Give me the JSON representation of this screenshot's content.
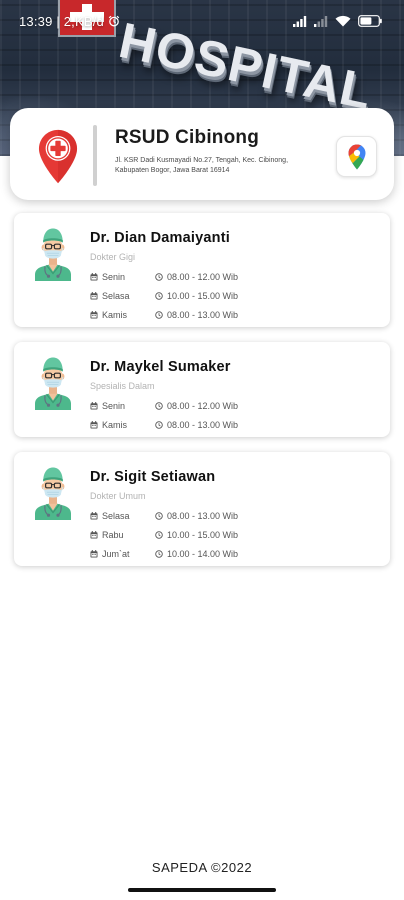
{
  "status_bar": {
    "time_text": "13:39 | 2,KB/d",
    "icons": [
      "alarm-icon",
      "signal-icon",
      "signal-icon",
      "wifi-icon",
      "battery-icon"
    ]
  },
  "header": {
    "sign_text": "HOSPITAL",
    "sign_icon": "red-cross-sign-icon"
  },
  "hospital": {
    "name": "RSUD Cibinong",
    "address": "Jl. KSR Dadi Kusmayadi No.27, Tengah, Kec. Cibinong, Kabupaten Bogor, Jawa Barat 16914",
    "icon": "hospital-location-pin-icon",
    "maps_button_icon": "google-maps-icon"
  },
  "schedule_icons": {
    "day": "calendar-icon",
    "time": "clock-icon"
  },
  "doctors": [
    {
      "name": "Dr. Dian Damaiyanti",
      "specialty": "Dokter Gigi",
      "avatar_icon": "doctor-avatar-icon",
      "schedule": [
        {
          "day": "Senin",
          "time": "08.00 - 12.00 Wib"
        },
        {
          "day": "Selasa",
          "time": "10.00 - 15.00 Wib"
        },
        {
          "day": "Kamis",
          "time": "08.00 - 13.00 Wib"
        }
      ]
    },
    {
      "name": "Dr. Maykel Sumaker",
      "specialty": "Spesialis Dalam",
      "avatar_icon": "doctor-avatar-icon",
      "schedule": [
        {
          "day": "Senin",
          "time": "08.00 - 12.00 Wib"
        },
        {
          "day": "Kamis",
          "time": "08.00 - 13.00 Wib"
        }
      ]
    },
    {
      "name": "Dr. Sigit Setiawan",
      "specialty": "Dokter Umum",
      "avatar_icon": "doctor-avatar-icon",
      "schedule": [
        {
          "day": "Selasa",
          "time": "08.00 - 13.00 Wib"
        },
        {
          "day": "Rabu",
          "time": "10.00 - 15.00 Wib"
        },
        {
          "day": "Jum`at",
          "time": "10.00 - 14.00 Wib"
        }
      ]
    }
  ],
  "footer": {
    "text": "SAPEDA ©2022"
  },
  "colors": {
    "accent_red": "#e53935",
    "scrubs_green": "#4db88c",
    "text_dark": "#1b1b1b",
    "text_muted": "#b3b3b3",
    "header_dark": "#222d3d"
  }
}
